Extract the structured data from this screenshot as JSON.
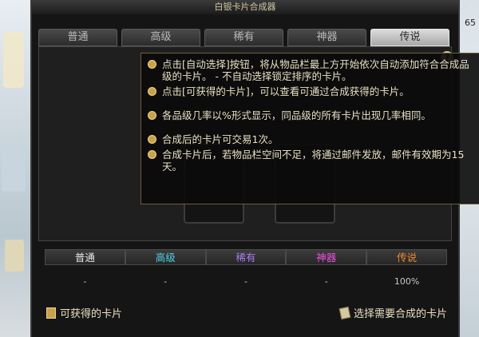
{
  "window": {
    "title": "白银卡片合成器",
    "close": "×",
    "side_label": "65"
  },
  "tabs": [
    {
      "label": "普通",
      "active": false
    },
    {
      "label": "高级",
      "active": false
    },
    {
      "label": "稀有",
      "active": false
    },
    {
      "label": "神器",
      "active": false
    },
    {
      "label": "传说",
      "active": true
    }
  ],
  "help_icon": "?",
  "tooltip": {
    "items": [
      {
        "text": "点击[自动选择]按钮，将从物品栏最上方开始依次自动添加符合合成品级的卡片。 - 不自动选择锁定排序的卡片。"
      },
      {
        "text": "点击[可获得的卡片]，可以查看可通过合成获得的卡片。"
      },
      {
        "text": "各品级几率以%形式显示，同品级的所有卡片出现几率相同。"
      },
      {
        "text": "合成后的卡片可交易1次。"
      },
      {
        "text": "合成卡片后，若物品栏空间不足，将通过邮件发放，邮件有效期为15天。"
      }
    ]
  },
  "rates": {
    "headers": [
      "普通",
      "高级",
      "稀有",
      "神器",
      "传说"
    ],
    "header_colors": [
      "#e8e8e8",
      "#4fd3e8",
      "#a97cf0",
      "#ee4ee0",
      "#f08a2a"
    ],
    "values": [
      "-",
      "-",
      "-",
      "-",
      "100%"
    ]
  },
  "footer": {
    "obtainable_label": "可获得的卡片",
    "select_label": "选择需要合成的卡片"
  }
}
